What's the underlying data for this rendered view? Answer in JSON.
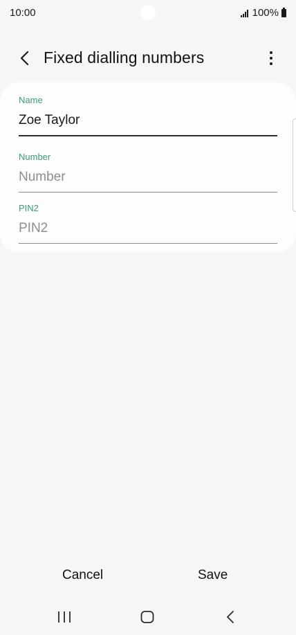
{
  "status_bar": {
    "time": "10:00",
    "battery": "100%"
  },
  "app_bar": {
    "title": "Fixed dialling numbers",
    "back_icon": "chevron-left-icon",
    "more_icon": "more-vertical-icon"
  },
  "form": {
    "name": {
      "label": "Name",
      "value": "Zoe Taylor",
      "placeholder": ""
    },
    "number": {
      "label": "Number",
      "value": "",
      "placeholder": "Number"
    },
    "pin2": {
      "label": "PIN2",
      "value": "",
      "placeholder": "PIN2"
    }
  },
  "actions": {
    "cancel_label": "Cancel",
    "save_label": "Save"
  },
  "nav_bar": {
    "recents_icon": "recents-icon",
    "home_icon": "home-icon",
    "back_icon": "back-icon"
  },
  "colors": {
    "accent": "#3a9c72",
    "background": "#f6f6f6",
    "card": "#fdfdfd"
  }
}
